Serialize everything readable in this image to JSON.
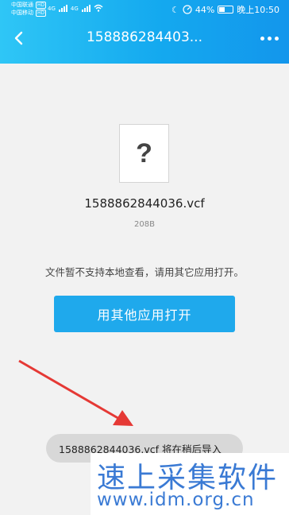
{
  "status_bar": {
    "carrier1": "中国联通",
    "carrier2": "中国移动",
    "hd": "HD",
    "net1": "4G",
    "net2": "4G",
    "battery": "44%",
    "battery_level": 0.44,
    "time": "晚上10:50"
  },
  "navbar": {
    "title": "158886284403..."
  },
  "file": {
    "name": "1588862844036.vcf",
    "size": "208B",
    "icon_glyph": "?"
  },
  "notice": "文件暂不支持本地查看，请用其它应用打开。",
  "open_button": "用其他应用打开",
  "toast": "1588862844036.vcf 将在稍后导入",
  "watermark": {
    "title": "速上采集软件",
    "url": "www.idm.org.cn"
  },
  "colors": {
    "accent": "#1fa9ec",
    "arrow": "#e53935"
  }
}
